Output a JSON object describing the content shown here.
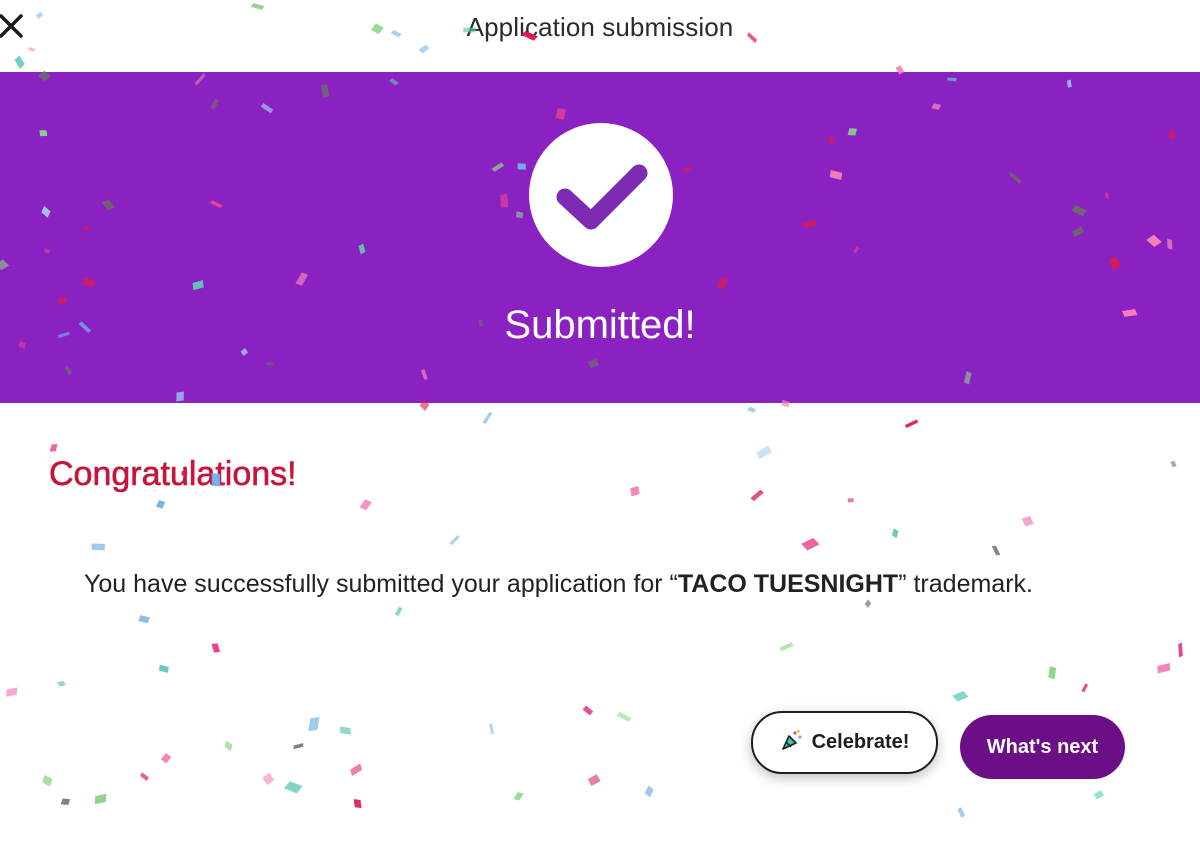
{
  "header": {
    "title": "Application submission",
    "close_icon": "close-icon"
  },
  "banner": {
    "status_text": "Submitted!",
    "check_icon": "checkmark-icon",
    "background_color": "#8a22c1"
  },
  "content": {
    "heading": "Congratulations!",
    "heading_color": "#c8143b",
    "message_prefix": "You have successfully submitted your application for “",
    "trademark_name": "TACO TUESNIGHT",
    "message_suffix": "” trademark."
  },
  "actions": {
    "celebrate_label": "Celebrate!",
    "celebrate_icon": "party-popper-icon",
    "next_label": "What's next",
    "next_color": "#6c0f86"
  },
  "decoration": {
    "confetti_colors": [
      "#e8418e",
      "#5ec9b6",
      "#6fb0e8",
      "#d81b4a",
      "#8fd48a",
      "#6b6b6b",
      "#f47fb8",
      "#a3cdf2"
    ]
  }
}
